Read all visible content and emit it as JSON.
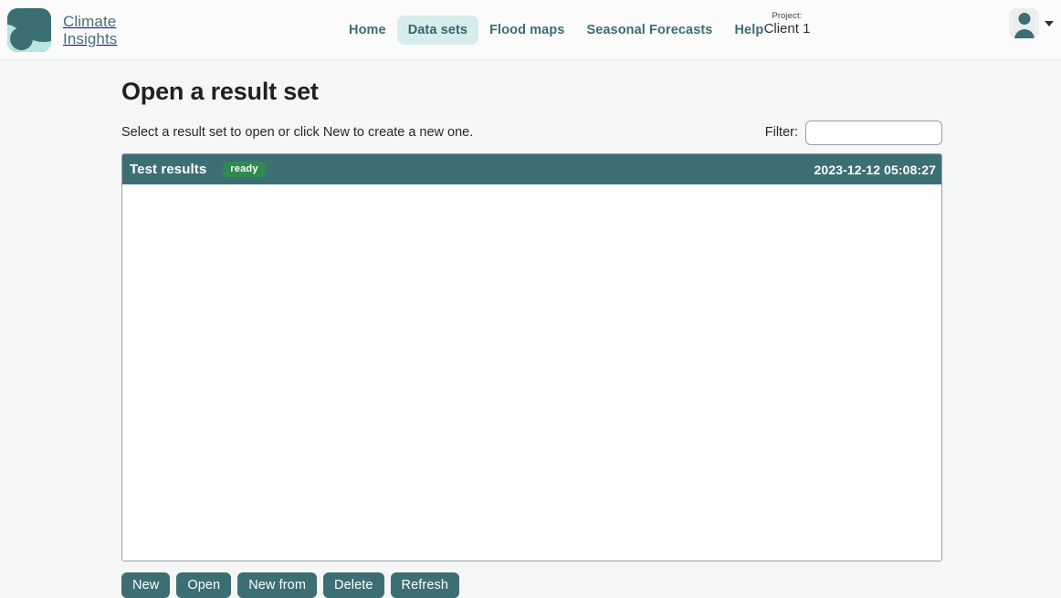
{
  "header": {
    "brand": {
      "line1": "Climate",
      "line2": "Insights",
      "logo_icon": "climate-wave-logo",
      "logo_dark": "#3c6f74",
      "logo_light": "#b9e6e0"
    },
    "nav": [
      {
        "label": "Home",
        "active": false
      },
      {
        "label": "Data sets",
        "active": true
      },
      {
        "label": "Flood maps",
        "active": false
      },
      {
        "label": "Seasonal Forecasts",
        "active": false
      },
      {
        "label": "Help",
        "active": false
      }
    ],
    "project": {
      "caption": "Project:",
      "value": "Client 1"
    },
    "user": {
      "avatar_icon": "user-avatar-icon",
      "caret_icon": "chevron-down-icon"
    }
  },
  "page": {
    "title": "Open a result set",
    "subtitle": "Select a result set to open or click New to create a new one."
  },
  "filter": {
    "label": "Filter:",
    "value": "",
    "placeholder": ""
  },
  "results": {
    "rows": [
      {
        "name": "Test results",
        "status": "ready",
        "status_color": "#2f8a52",
        "date": "2023-12-12 05:08:27",
        "selected": true
      }
    ]
  },
  "actions": [
    {
      "label": "New"
    },
    {
      "label": "Open"
    },
    {
      "label": "New from"
    },
    {
      "label": "Delete"
    },
    {
      "label": "Refresh"
    }
  ],
  "colors": {
    "accent": "#3c6f74",
    "accent_light": "#d6eced",
    "page_background": "#f5f6f6",
    "header_background": "#fbfbfc"
  }
}
